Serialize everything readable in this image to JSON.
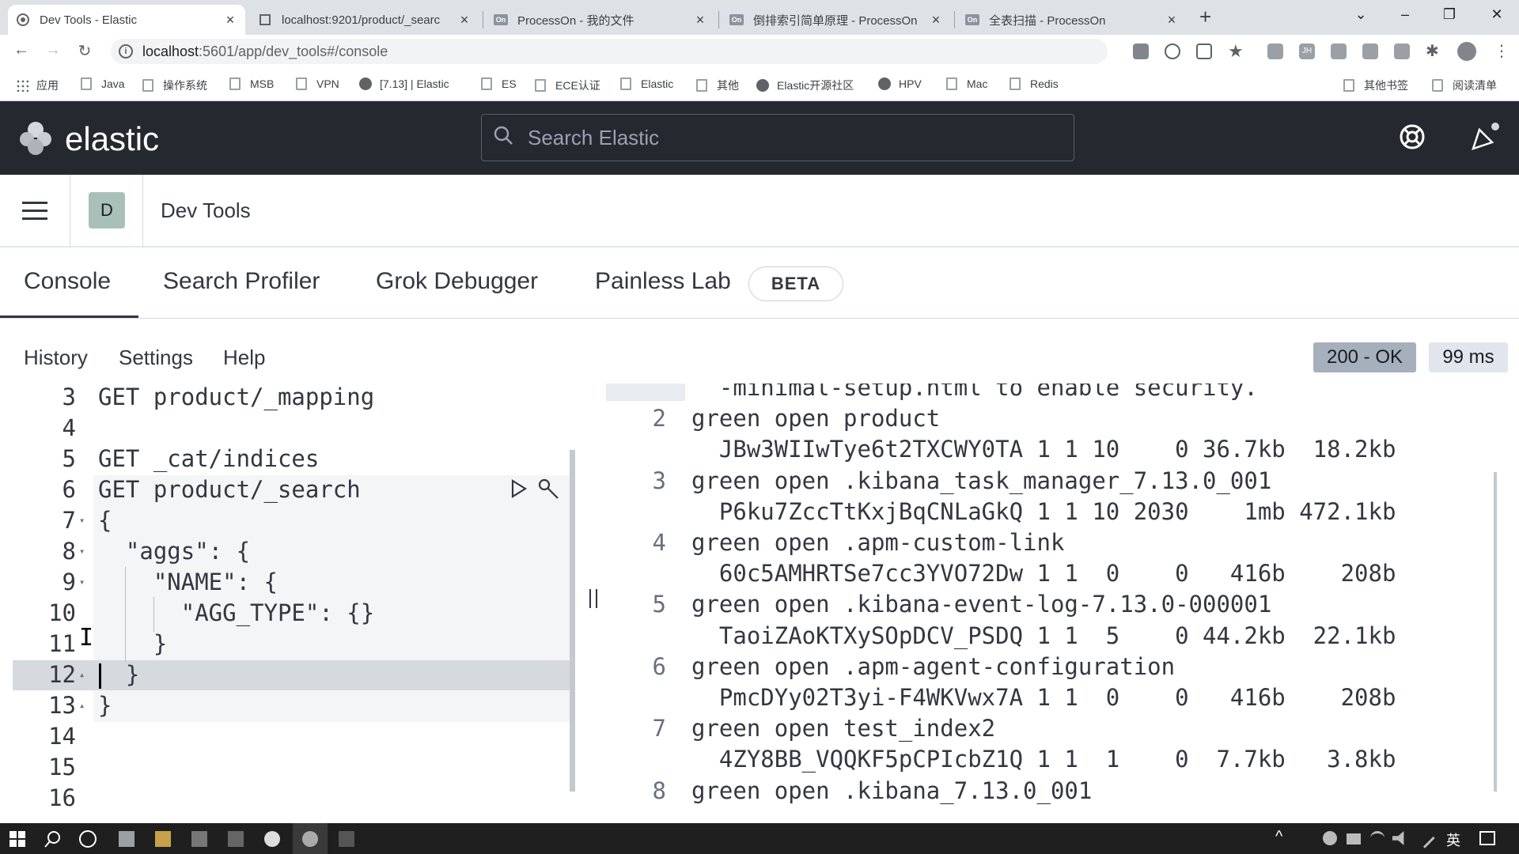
{
  "browser": {
    "tabs": [
      {
        "title": "Dev Tools - Elastic",
        "active": true
      },
      {
        "title": "localhost:9201/product/_searc",
        "active": false
      },
      {
        "title": "ProcessOn - 我的文件",
        "active": false
      },
      {
        "title": "倒排索引简单原理 - ProcessOn",
        "active": false
      },
      {
        "title": "全表扫描 - ProcessOn",
        "active": false
      }
    ],
    "favicon_text": "On",
    "new_tab": "+",
    "close": "×",
    "url_host": "localhost",
    "url_rest": ":5601/app/dev_tools#/console",
    "bookmarks": [
      "应用",
      "Java",
      "操作系统",
      "MSB",
      "VPN",
      "[7.13] | Elastic",
      "ES",
      "ECE认证",
      "Elastic",
      "其他",
      "Elastic开源社区",
      "HPV",
      "Mac",
      "Redis"
    ],
    "bookmarks_right": [
      "其他书签",
      "阅读清单"
    ],
    "ext_initials": "JH"
  },
  "kibana": {
    "brand": "elastic",
    "search_placeholder": "Search Elastic",
    "space_initial": "D",
    "breadcrumb": "Dev Tools",
    "tabs": [
      "Console",
      "Search Profiler",
      "Grok Debugger",
      "Painless Lab"
    ],
    "beta": "BETA",
    "toolbar": [
      "History",
      "Settings",
      "Help"
    ],
    "status": "200 - OK",
    "status_color": "#a5b0bc",
    "time": "99 ms",
    "accent": "#006bb8"
  },
  "editor_lines": [
    {
      "n": "3",
      "text": "GET product/_mapping",
      "fold": ""
    },
    {
      "n": "4",
      "text": "",
      "fold": ""
    },
    {
      "n": "5",
      "text": "GET _cat/indices",
      "fold": ""
    },
    {
      "n": "6",
      "text": "GET product/_search",
      "fold": ""
    },
    {
      "n": "7",
      "text": "{",
      "fold": "▾"
    },
    {
      "n": "8",
      "text": "  \"aggs\": {",
      "fold": "▾"
    },
    {
      "n": "9",
      "text": "    \"NAME\": {",
      "fold": "▾"
    },
    {
      "n": "10",
      "text": "      \"AGG_TYPE\": {}",
      "fold": ""
    },
    {
      "n": "11",
      "text": "    }",
      "fold": ""
    },
    {
      "n": "12",
      "text": "  }",
      "fold": "▴"
    },
    {
      "n": "13",
      "text": "}",
      "fold": "▴"
    },
    {
      "n": "14",
      "text": "",
      "fold": ""
    },
    {
      "n": "15",
      "text": "",
      "fold": ""
    },
    {
      "n": "16",
      "text": "",
      "fold": ""
    }
  ],
  "output_lines": [
    {
      "n": "",
      "text": "  -minimal-setup.html to enable security."
    },
    {
      "n": "2",
      "text": "green open product"
    },
    {
      "n": "",
      "text": "  JBw3WIIwTye6t2TXCWY0TA 1 1 10    0 36.7kb  18.2kb"
    },
    {
      "n": "3",
      "text": "green open .kibana_task_manager_7.13.0_001"
    },
    {
      "n": "",
      "text": "  P6ku7ZccTtKxjBqCNLaGkQ 1 1 10 2030    1mb 472.1kb"
    },
    {
      "n": "4",
      "text": "green open .apm-custom-link"
    },
    {
      "n": "",
      "text": "  60c5AMHRTSe7cc3YVO72Dw 1 1  0    0   416b    208b"
    },
    {
      "n": "5",
      "text": "green open .kibana-event-log-7.13.0-000001"
    },
    {
      "n": "",
      "text": "  TaoiZAoKTXySOpDCV_PSDQ 1 1  5    0 44.2kb  22.1kb"
    },
    {
      "n": "6",
      "text": "green open .apm-agent-configuration"
    },
    {
      "n": "",
      "text": "  PmcDYy02T3yi-F4WKVwx7A 1 1  0    0   416b    208b"
    },
    {
      "n": "7",
      "text": "green open test_index2"
    },
    {
      "n": "",
      "text": "  4ZY8BB_VQQKF5pCPIcbZ1Q 1 1  1    0  7.7kb   3.8kb"
    },
    {
      "n": "8",
      "text": "green open .kibana_7.13.0_001"
    }
  ],
  "taskbar": {
    "ime": "英"
  }
}
